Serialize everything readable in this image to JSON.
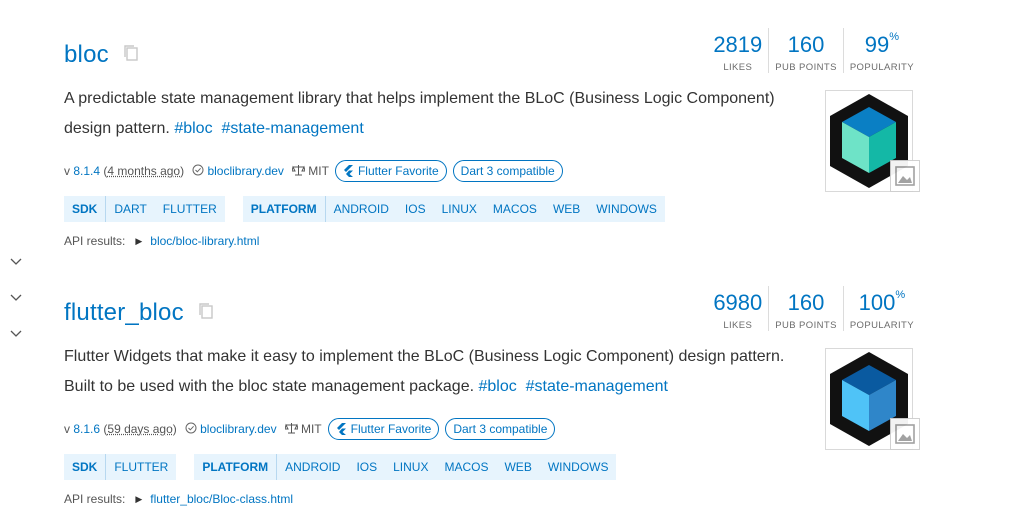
{
  "sidebar": {
    "chevrons": [
      "chevron-1",
      "chevron-2",
      "chevron-3"
    ]
  },
  "packages": [
    {
      "name": "bloc",
      "description": "A predictable state management library that helps implement the BLoC (Business Logic Component) design pattern.",
      "tags": [
        "#bloc",
        "#state-management"
      ],
      "metrics": {
        "likes": {
          "value": "2819",
          "label": "LIKES"
        },
        "pub_points": {
          "value": "160",
          "label": "PUB POINTS"
        },
        "popularity": {
          "value": "99",
          "suffix": "%",
          "label": "POPULARITY"
        }
      },
      "version_prefix": "v",
      "version": "8.1.4",
      "ago": "4 months ago",
      "publisher": "bloclibrary.dev",
      "license": "MIT",
      "badges": [
        "Flutter Favorite",
        "Dart 3 compatible"
      ],
      "sdk": {
        "label": "SDK",
        "items": [
          "DART",
          "FLUTTER"
        ]
      },
      "platform": {
        "label": "PLATFORM",
        "items": [
          "ANDROID",
          "IOS",
          "LINUX",
          "MACOS",
          "WEB",
          "WINDOWS"
        ]
      },
      "api_label": "API results:",
      "api_link": "bloc/bloc-library.html",
      "logo_colors": {
        "top": "#0a7fc4",
        "left": "#6ee3c7",
        "right": "#14b8a6"
      }
    },
    {
      "name": "flutter_bloc",
      "description": "Flutter Widgets that make it easy to implement the BLoC (Business Logic Component) design pattern. Built to be used with the bloc state management package.",
      "tags": [
        "#bloc",
        "#state-management"
      ],
      "metrics": {
        "likes": {
          "value": "6980",
          "label": "LIKES"
        },
        "pub_points": {
          "value": "160",
          "label": "PUB POINTS"
        },
        "popularity": {
          "value": "100",
          "suffix": "%",
          "label": "POPULARITY"
        }
      },
      "version_prefix": "v",
      "version": "8.1.6",
      "ago": "59 days ago",
      "publisher": "bloclibrary.dev",
      "license": "MIT",
      "badges": [
        "Flutter Favorite",
        "Dart 3 compatible"
      ],
      "sdk": {
        "label": "SDK",
        "items": [
          "FLUTTER"
        ]
      },
      "platform": {
        "label": "PLATFORM",
        "items": [
          "ANDROID",
          "IOS",
          "LINUX",
          "MACOS",
          "WEB",
          "WINDOWS"
        ]
      },
      "api_label": "API results:",
      "api_link": "flutter_bloc/Bloc-class.html",
      "logo_colors": {
        "top": "#0a5aa0",
        "left": "#4fc3f7",
        "right": "#2f86c9"
      }
    }
  ],
  "colors": {
    "link": "#0175c2",
    "chip_bg": "#e7f4fd"
  }
}
